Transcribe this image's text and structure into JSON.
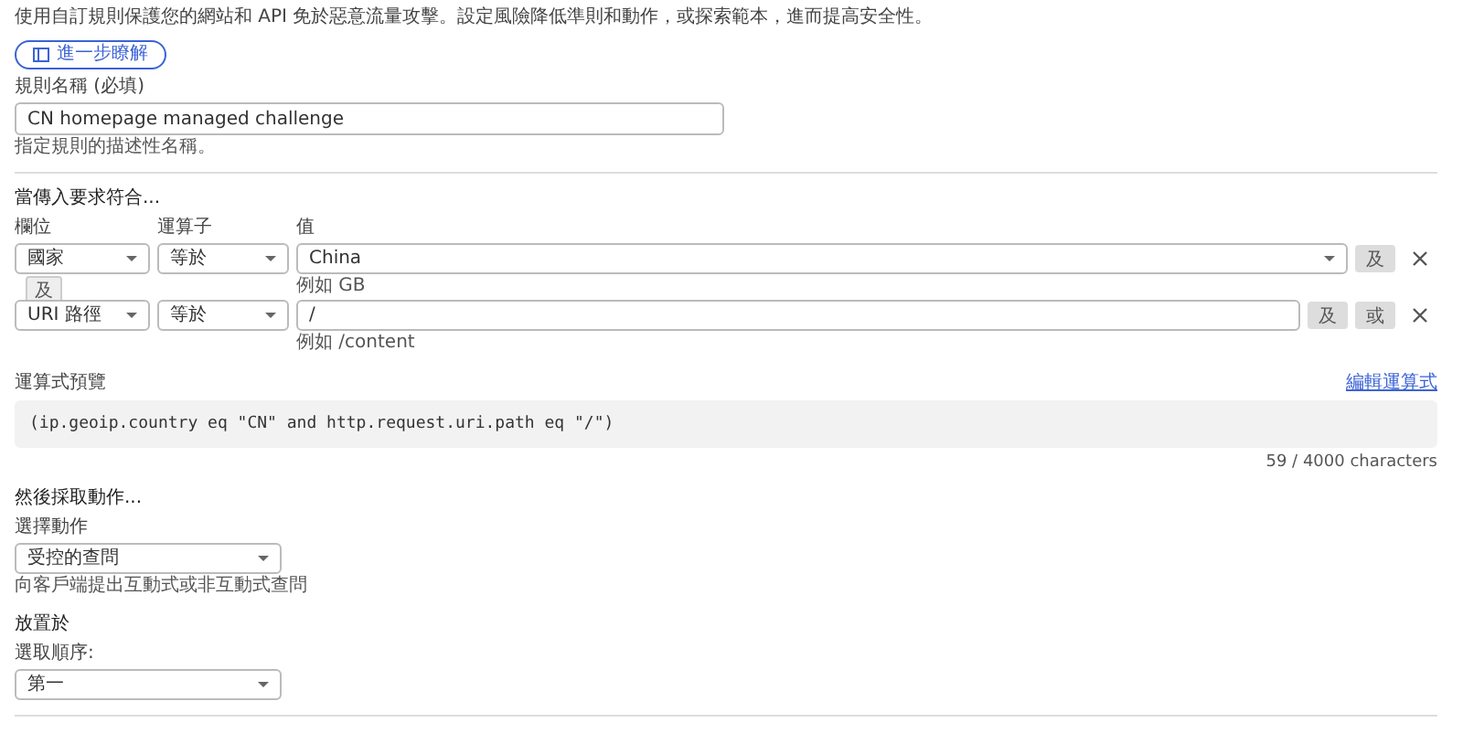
{
  "intro": "使用自訂規則保護您的網站和 API 免於惡意流量攻擊。設定風險降低準則和動作，或探索範本，進而提高安全性。",
  "learn_more": {
    "label": "進一步瞭解"
  },
  "rule_name": {
    "label": "規則名稱 (必填)",
    "value": "CN homepage managed challenge",
    "hint": "指定規則的描述性名稱。"
  },
  "conditions": {
    "title": "當傳入要求符合...",
    "column_headers": [
      "欄位",
      "運算子",
      "值"
    ],
    "rows": [
      {
        "field": "國家",
        "operator": "等於",
        "value": {
          "kind": "select",
          "text": "China"
        },
        "hint": "例如 GB",
        "buttons": [
          "及"
        ]
      },
      {
        "field": "URI 路徑",
        "operator": "等於",
        "value": {
          "kind": "text",
          "text": "/"
        },
        "hint": "例如 /content",
        "buttons": [
          "及",
          "或"
        ]
      }
    ],
    "connector": "及"
  },
  "expression": {
    "label": "運算式預覽",
    "edit_link": "編輯運算式",
    "code": "(ip.geoip.country eq \"CN\" and http.request.uri.path eq \"/\")",
    "counter": "59 / 4000 characters"
  },
  "action": {
    "title": "然後採取動作...",
    "label": "選擇動作",
    "value": "受控的查問",
    "hint": "向客戶端提出互動式或非互動式查問"
  },
  "placement": {
    "title": "放置於",
    "label": "選取順序:",
    "value": "第一"
  }
}
